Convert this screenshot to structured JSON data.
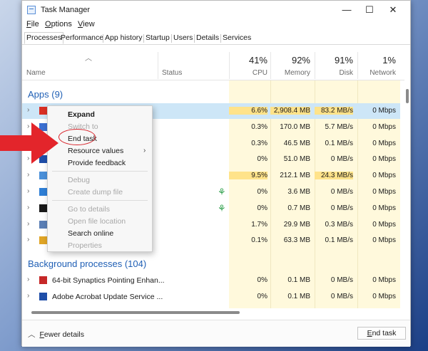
{
  "window": {
    "title": "Task Manager",
    "controls": [
      "—",
      "☐",
      "✕"
    ]
  },
  "menu": [
    {
      "underline": "F",
      "rest": "ile"
    },
    {
      "underline": "O",
      "rest": "ptions"
    },
    {
      "underline": "V",
      "rest": "iew"
    }
  ],
  "tabs": [
    "Processes",
    "Performance",
    "App history",
    "Startup",
    "Users",
    "Details",
    "Services"
  ],
  "columns": {
    "name": "Name",
    "status": "Status",
    "cpu": {
      "pct": "41%",
      "label": "CPU"
    },
    "memory": {
      "pct": "92%",
      "label": "Memory"
    },
    "disk": {
      "pct": "91%",
      "label": "Disk"
    },
    "network": {
      "pct": "1%",
      "label": "Network"
    }
  },
  "sections": {
    "apps": "Apps (9)",
    "background": "Background processes (104)"
  },
  "app_rows": [
    {
      "icon_color": "#d93025",
      "cpu": "6.6%",
      "memory": "2,908.4 MB",
      "disk": "83.2 MB/s",
      "network": "0 Mbps"
    },
    {
      "icon_color": "#3b6fd1",
      "cpu": "0.3%",
      "memory": "170.0 MB",
      "disk": "5.7 MB/s",
      "network": "0 Mbps"
    },
    {
      "icon_color": "#2a9d4b",
      "cpu": "0.3%",
      "memory": "46.5 MB",
      "disk": "0.1 MB/s",
      "network": "0 Mbps"
    },
    {
      "icon_color": "#1f4ea8",
      "cpu": "0%",
      "memory": "51.0 MB",
      "disk": "0 MB/s",
      "network": "0 Mbps"
    },
    {
      "icon_color": "#4a90d9",
      "cpu": "9.5%",
      "memory": "212.1 MB",
      "disk": "24.3 MB/s",
      "network": "0 Mbps"
    },
    {
      "icon_color": "#2f7fd6",
      "cpu": "0%",
      "memory": "3.6 MB",
      "disk": "0 MB/s",
      "network": "0 Mbps"
    },
    {
      "icon_color": "#1a1a1a",
      "cpu": "0%",
      "memory": "0.7 MB",
      "disk": "0 MB/s",
      "network": "0 Mbps"
    },
    {
      "icon_color": "#5b7fb5",
      "cpu": "1.7%",
      "memory": "29.9 MB",
      "disk": "0.3 MB/s",
      "network": "0 Mbps"
    },
    {
      "icon_color": "#e0a526",
      "cpu": "0.1%",
      "memory": "63.3 MB",
      "disk": "0.1 MB/s",
      "network": "0 Mbps"
    }
  ],
  "background_rows": [
    {
      "name": "64-bit Synaptics Pointing Enhan...",
      "icon_color": "#c62828",
      "cpu": "0%",
      "memory": "0.1 MB",
      "disk": "0 MB/s",
      "network": "0 Mbps"
    },
    {
      "name": "Adobe Acrobat Update Service ...",
      "icon_color": "#1f4ea8",
      "cpu": "0%",
      "memory": "0.1 MB",
      "disk": "0 MB/s",
      "network": "0 Mbps"
    }
  ],
  "context_menu": {
    "expand": "Expand",
    "switch_to": "Switch to",
    "end_task": "End task",
    "resource_values": "Resource values",
    "provide_feedback": "Provide feedback",
    "debug": "Debug",
    "create_dump_file": "Create dump file",
    "go_to_details": "Go to details",
    "open_file_location": "Open file location",
    "search_online": "Search online",
    "properties": "Properties"
  },
  "footer": {
    "fewer_details_u": "F",
    "fewer_details_rest": "ewer details",
    "end_task_u": "E",
    "end_task_rest": "nd task"
  },
  "colors": {
    "accent": "#1f5fb5",
    "selected_row": "#cde6f7",
    "heat_low": "#fff9dc",
    "heat_high": "#ffe38a",
    "annotation_red": "#d8242b"
  }
}
